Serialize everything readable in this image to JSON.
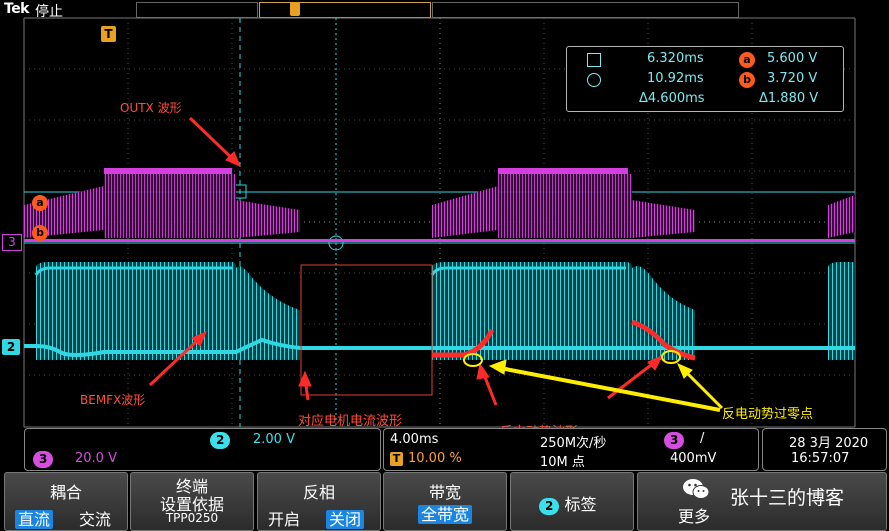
{
  "status_bar": {
    "brand": "Tek",
    "run_state": "停止",
    "trigger_marker": "T"
  },
  "measurements": {
    "cursor_a_time": "6.320ms",
    "cursor_b_time": "10.92ms",
    "delta_time": "Δ4.600ms",
    "cursor_a_value": "5.600 V",
    "cursor_b_value": "3.720 V",
    "delta_value": "Δ1.880 V",
    "badge_a": "a",
    "badge_b": "b"
  },
  "waveform": {
    "ch3_marker": "3",
    "ch2_marker": "2",
    "cursor_a_marker": "a",
    "cursor_b_marker": "b",
    "colors": {
      "ch2": "#2fd8e2",
      "ch3": "#d43fe0",
      "annotation": "#ff2a2a",
      "highlight": "#ffee00",
      "grid": "#5a5a5a"
    }
  },
  "annotations": {
    "outx": "OUTX 波形",
    "bemfx": "BEMFX波形",
    "motor_current": "对应电机电流波形",
    "back_emf": "反电动势波形",
    "back_emf_zero": "反电动势过零点"
  },
  "bottom_info": {
    "ch2_number": "2",
    "ch2_scale": "2.00 V",
    "ch3_number": "3",
    "ch3_scale": "20.0 V",
    "timebase": "4.00ms",
    "sample_rate": "250M次/秒",
    "trigger_icon": "T",
    "trigger_position": "10.00 %",
    "record_length": "10M 点",
    "trigger_channel": "3",
    "trigger_slope": "/",
    "trigger_level": "400mV",
    "date": "28 3月 2020",
    "time": "16:57:07"
  },
  "softkeys": {
    "coupling_title": "耦合",
    "coupling_dc": "直流",
    "coupling_ac": "交流",
    "termination_title": "终端",
    "termination_sub": "设置依据",
    "termination_probe": "TPP0250",
    "invert_title": "反相",
    "invert_on": "开启",
    "invert_off": "关闭",
    "bandwidth_title": "带宽",
    "bandwidth_value": "全带宽",
    "label_number": "2",
    "label_title": "标签",
    "more_title": "更多"
  },
  "watermark": {
    "text": "张十三的博客"
  }
}
